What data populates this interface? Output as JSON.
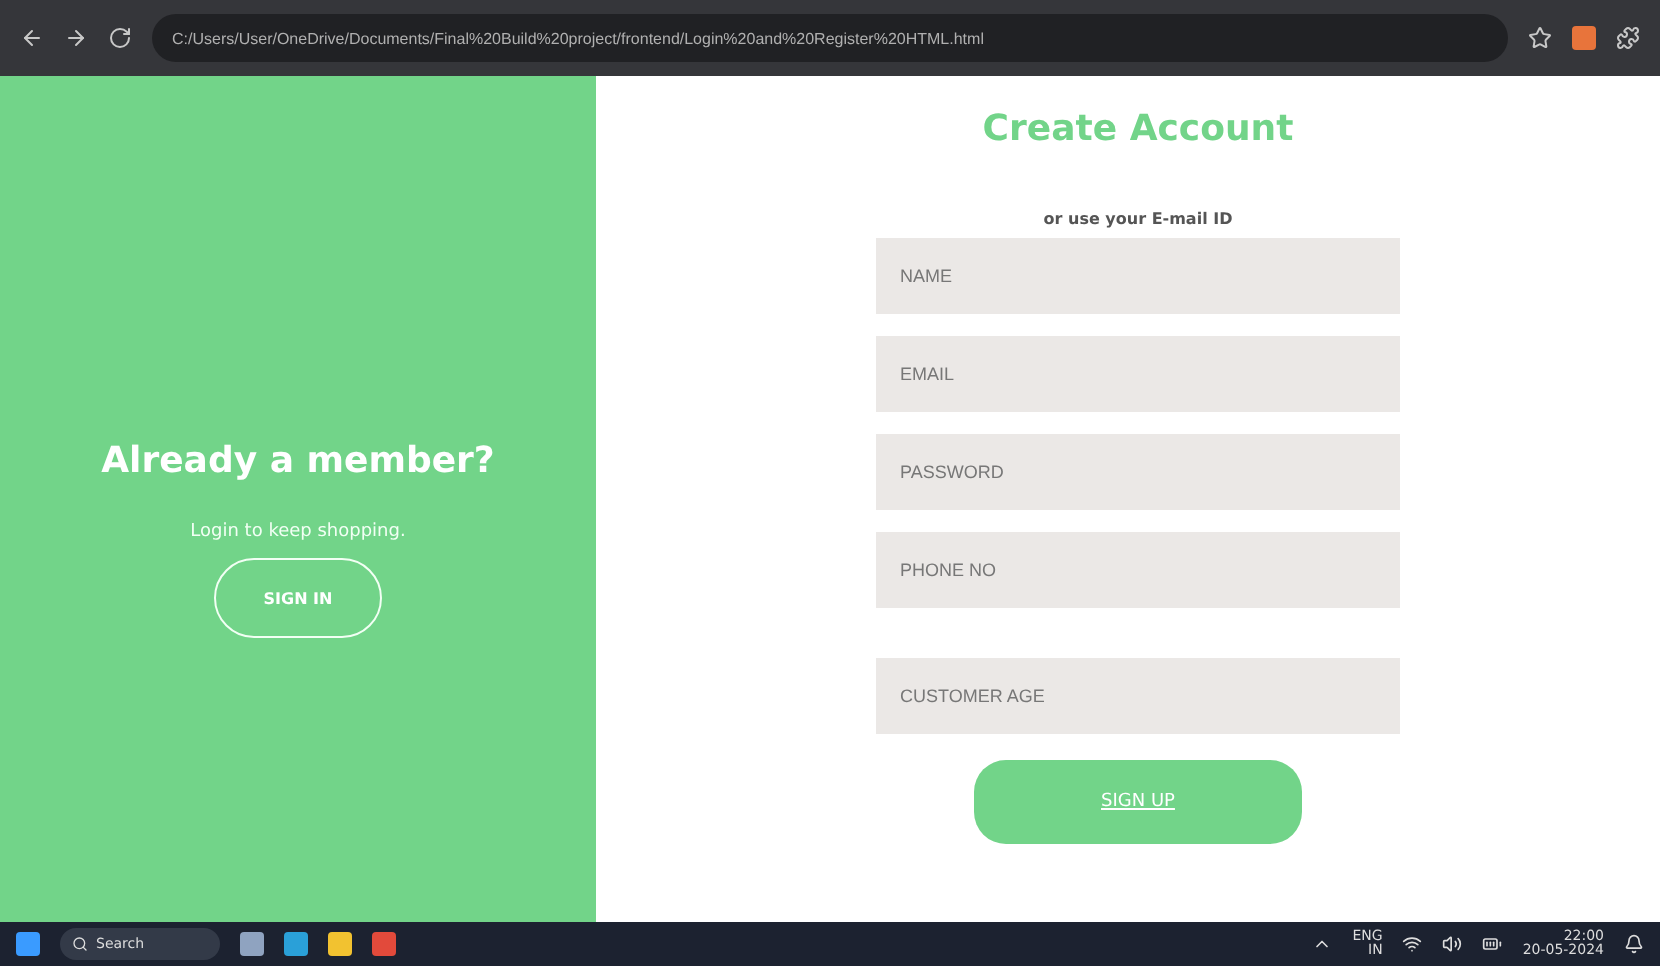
{
  "browser": {
    "url": "C:/Users/User/OneDrive/Documents/Final%20Build%20project/frontend/Login%20and%20Register%20HTML.html"
  },
  "welcome_panel": {
    "title": "Already a member?",
    "subtitle": "Login to keep shopping.",
    "button": "SIGN IN"
  },
  "signup_form": {
    "title": "Create Account",
    "hint": "or use your E-mail ID",
    "fields": [
      {
        "placeholder": "NAME"
      },
      {
        "placeholder": "EMAIL"
      },
      {
        "placeholder": "PASSWORD"
      },
      {
        "placeholder": "PHONE NO"
      },
      {
        "placeholder": "CUSTOMER AGE",
        "spaced": true
      }
    ],
    "button": "SIGN UP"
  },
  "taskbar": {
    "search": "Search",
    "language": "ENG",
    "region": "IN",
    "time": "22:00",
    "date": "20-05-2024"
  }
}
